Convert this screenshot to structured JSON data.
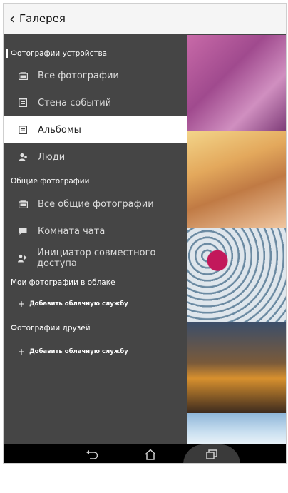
{
  "header": {
    "back_icon": "chevron-left",
    "title": "Галерея"
  },
  "sections": {
    "device": "Фотографии устройства",
    "shared": "Общие фотографии",
    "cloud": "Мои фотографии в облаке",
    "friends": "Фотографии друзей"
  },
  "items": {
    "all_photos": "Все фотографии",
    "events_wall": "Стена событий",
    "albums": "Альбомы",
    "people": "Люди",
    "all_shared": "Все общие фотографии",
    "chat_room": "Комната чата",
    "share_initiator": "Инициатор совместного доступа"
  },
  "actions": {
    "add_cloud_1": "Добавить облачную службу",
    "add_cloud_2": "Добавить облачную службу",
    "plus": "+"
  },
  "selected_item": "albums",
  "colors": {
    "drawer_bg": "#454545",
    "selected_bg": "#ffffff",
    "title_bar": "#f5f5f5",
    "nav_bar": "#000000"
  },
  "navbar": {
    "icons": [
      "back-icon",
      "home-icon",
      "recents-icon"
    ]
  }
}
